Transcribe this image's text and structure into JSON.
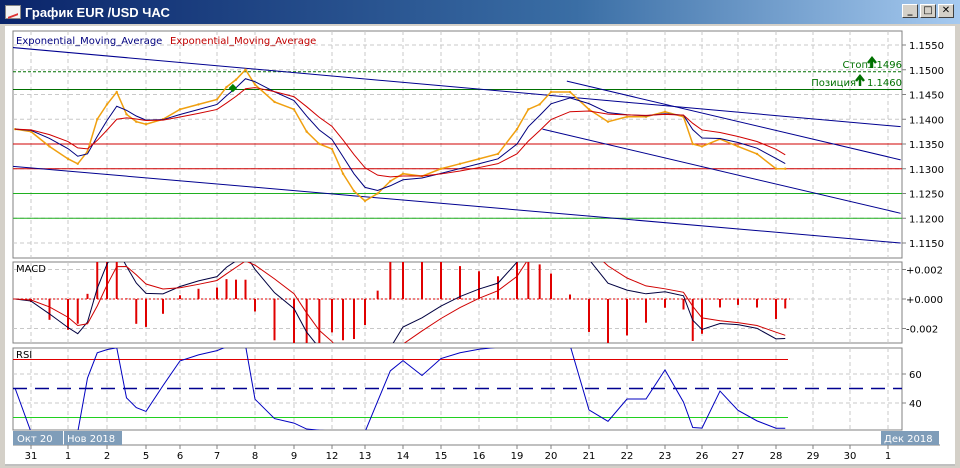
{
  "window": {
    "title": "График EUR /USD  ЧАС",
    "controls": [
      "_",
      "□",
      "✕"
    ]
  },
  "indicators": {
    "ema1": "Exponential_Moving_Average",
    "ema2": "Exponential_Moving_Average",
    "macd": "MACD",
    "rsi": "RSI"
  },
  "orders": {
    "stop_label": "Стоп",
    "stop_value": "1.1496",
    "position_label": "Позиция",
    "position_value": "1.1460"
  },
  "month_labels": [
    "Окт 20",
    "Нов 2018",
    "Дек 2018"
  ],
  "colors": {
    "price": "#f0a010",
    "ema_fast": "#00007f",
    "ema_slow": "#d00000",
    "trend": "#000090",
    "red_level": "#d00000",
    "green_level": "#20b020",
    "order": "#007000"
  },
  "chart_data": [
    {
      "type": "line",
      "title": "",
      "price_axis": {
        "ylim": [
          1.113,
          1.1575
        ],
        "ticks": [
          "1.1550",
          "1.1500",
          "1.1450",
          "1.1400",
          "1.1350",
          "1.1300",
          "1.1250",
          "1.1200",
          "1.1150"
        ]
      },
      "x_ticks": [
        {
          "label": "31",
          "date": "10-31"
        },
        {
          "label": "1",
          "date": "11-01"
        },
        {
          "label": "2",
          "date": "11-02"
        },
        {
          "label": "5",
          "date": "11-05"
        },
        {
          "label": "6",
          "date": "11-06"
        },
        {
          "label": "7",
          "date": "11-07"
        },
        {
          "label": "8",
          "date": "11-08"
        },
        {
          "label": "9",
          "date": "11-09"
        },
        {
          "label": "12",
          "date": "11-12"
        },
        {
          "label": "13",
          "date": "11-13"
        },
        {
          "label": "14",
          "date": "11-14"
        },
        {
          "label": "15",
          "date": "11-15"
        },
        {
          "label": "16",
          "date": "11-16"
        },
        {
          "label": "19",
          "date": "11-19"
        },
        {
          "label": "20",
          "date": "11-20"
        },
        {
          "label": "21",
          "date": "11-21"
        },
        {
          "label": "22",
          "date": "11-22"
        },
        {
          "label": "23",
          "date": "11-23"
        },
        {
          "label": "26",
          "date": "11-26"
        },
        {
          "label": "27",
          "date": "11-27"
        },
        {
          "label": "28",
          "date": "11-28"
        },
        {
          "label": "29",
          "date": "11-29"
        },
        {
          "label": "30",
          "date": "11-30"
        },
        {
          "label": "1",
          "date": "12-01"
        }
      ],
      "price": [
        [
          "10-30 14",
          1.138
        ],
        [
          "10-31 00",
          1.1375
        ],
        [
          "10-31 12",
          1.1345
        ],
        [
          "11-01 00",
          1.132
        ],
        [
          "11-01 06",
          1.131
        ],
        [
          "11-01 12",
          1.1335
        ],
        [
          "11-01 18",
          1.14
        ],
        [
          "11-02 00",
          1.143
        ],
        [
          "11-02 06",
          1.1455
        ],
        [
          "11-02 12",
          1.141
        ],
        [
          "11-02 18",
          1.1395
        ],
        [
          "11-05 00",
          1.139
        ],
        [
          "11-05 12",
          1.14
        ],
        [
          "11-06 00",
          1.142
        ],
        [
          "11-06 12",
          1.143
        ],
        [
          "11-07 00",
          1.144
        ],
        [
          "11-07 06",
          1.1465
        ],
        [
          "11-07 12",
          1.148
        ],
        [
          "11-07 18",
          1.15
        ],
        [
          "11-08 00",
          1.147
        ],
        [
          "11-08 12",
          1.1435
        ],
        [
          "11-09 00",
          1.142
        ],
        [
          "11-09 08",
          1.1375
        ],
        [
          "11-09 16",
          1.135
        ],
        [
          "11-12 00",
          1.134
        ],
        [
          "11-12 08",
          1.129
        ],
        [
          "11-12 16",
          1.1255
        ],
        [
          "11-13 00",
          1.1235
        ],
        [
          "11-13 08",
          1.125
        ],
        [
          "11-13 16",
          1.1275
        ],
        [
          "11-14 00",
          1.129
        ],
        [
          "11-14 12",
          1.1285
        ],
        [
          "11-15 00",
          1.13
        ],
        [
          "11-15 12",
          1.131
        ],
        [
          "11-16 00",
          1.132
        ],
        [
          "11-16 12",
          1.133
        ],
        [
          "11-19 00",
          1.138
        ],
        [
          "11-19 08",
          1.142
        ],
        [
          "11-19 16",
          1.143
        ],
        [
          "11-20 00",
          1.1455
        ],
        [
          "11-20 12",
          1.1455
        ],
        [
          "11-21 00",
          1.142
        ],
        [
          "11-21 12",
          1.1395
        ],
        [
          "11-22 00",
          1.1405
        ],
        [
          "11-22 12",
          1.1405
        ],
        [
          "11-23 00",
          1.1415
        ],
        [
          "11-23 12",
          1.1405
        ],
        [
          "11-23 18",
          1.135
        ],
        [
          "11-26 00",
          1.1345
        ],
        [
          "11-26 12",
          1.136
        ],
        [
          "11-27 00",
          1.1345
        ],
        [
          "11-27 12",
          1.133
        ],
        [
          "11-28 00",
          1.13
        ],
        [
          "11-28 06",
          1.13
        ]
      ],
      "trend_lines": [
        [
          [
            "10-30 12",
            1.1545
          ],
          [
            "12-01 08",
            1.1385
          ]
        ],
        [
          [
            "10-30 12",
            1.1305
          ],
          [
            "12-01 08",
            1.115
          ]
        ],
        [
          [
            "11-20 10",
            1.1477
          ],
          [
            "12-01 08",
            1.1318
          ]
        ],
        [
          [
            "11-19 18",
            1.138
          ],
          [
            "12-01 08",
            1.121
          ]
        ]
      ],
      "red_levels": [
        1.135,
        1.13
      ],
      "green_levels": [
        1.125,
        1.12
      ],
      "position_level": 1.146,
      "stop_level": 1.1496,
      "marker": [
        "11-07 10",
        1.1463
      ]
    },
    {
      "type": "line",
      "title": "MACD",
      "axis": {
        "ticks": [
          "+0.002",
          "+0.000",
          "-0.002"
        ],
        "ylim": [
          -0.003,
          0.003
        ]
      }
    },
    {
      "type": "line",
      "title": "RSI",
      "axis": {
        "ticks": [
          "60",
          "40"
        ]
      },
      "levels": [
        70,
        50,
        30
      ]
    }
  ]
}
